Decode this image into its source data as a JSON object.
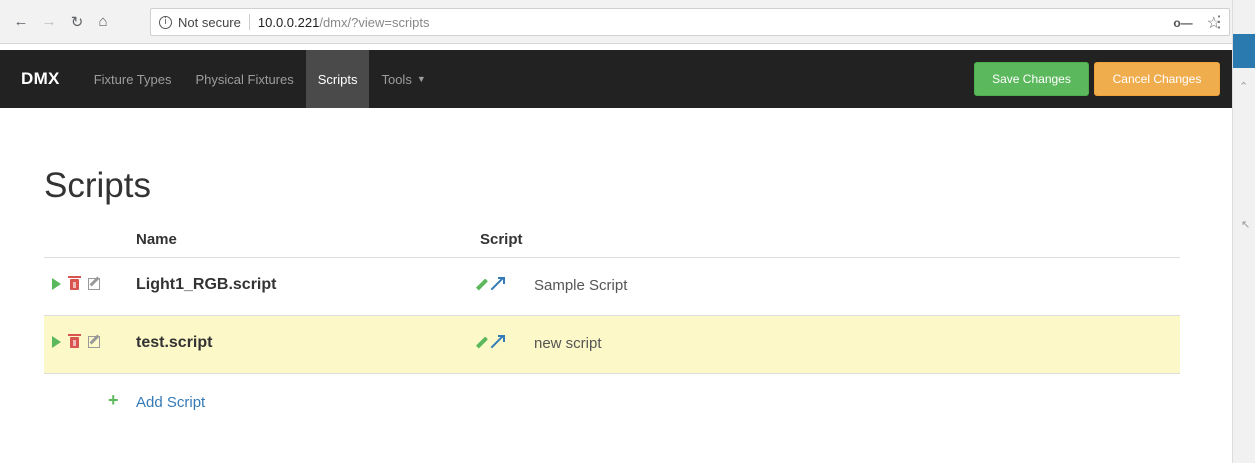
{
  "browser": {
    "security_text": "Not secure",
    "url_host": "10.0.0.221",
    "url_path": "/dmx/?view=scripts"
  },
  "navbar": {
    "brand": "DMX",
    "items": [
      {
        "label": "Fixture Types",
        "active": false
      },
      {
        "label": "Physical Fixtures",
        "active": false
      },
      {
        "label": "Scripts",
        "active": true
      },
      {
        "label": "Tools",
        "active": false,
        "dropdown": true
      }
    ],
    "save_label": "Save Changes",
    "cancel_label": "Cancel Changes"
  },
  "page": {
    "title": "Scripts"
  },
  "table": {
    "columns": [
      "Name",
      "Script"
    ],
    "rows": [
      {
        "name": "Light1_RGB.script",
        "script": "Sample Script",
        "highlight": false
      },
      {
        "name": "test.script",
        "script": "new script",
        "highlight": true
      }
    ],
    "add_label": "Add Script"
  },
  "colors": {
    "navbar_bg": "#222222",
    "save_green": "#5cb85c",
    "cancel_orange": "#f0ad4e",
    "highlight_row": "#fcf8c8",
    "link_blue": "#337ab7",
    "delete_red": "#d9534f"
  },
  "icons": {
    "row_actions": [
      "play-icon",
      "trash-icon",
      "edit-icon"
    ],
    "script_actions": [
      "pencil-icon",
      "expand-icon"
    ],
    "add": "plus-icon"
  }
}
